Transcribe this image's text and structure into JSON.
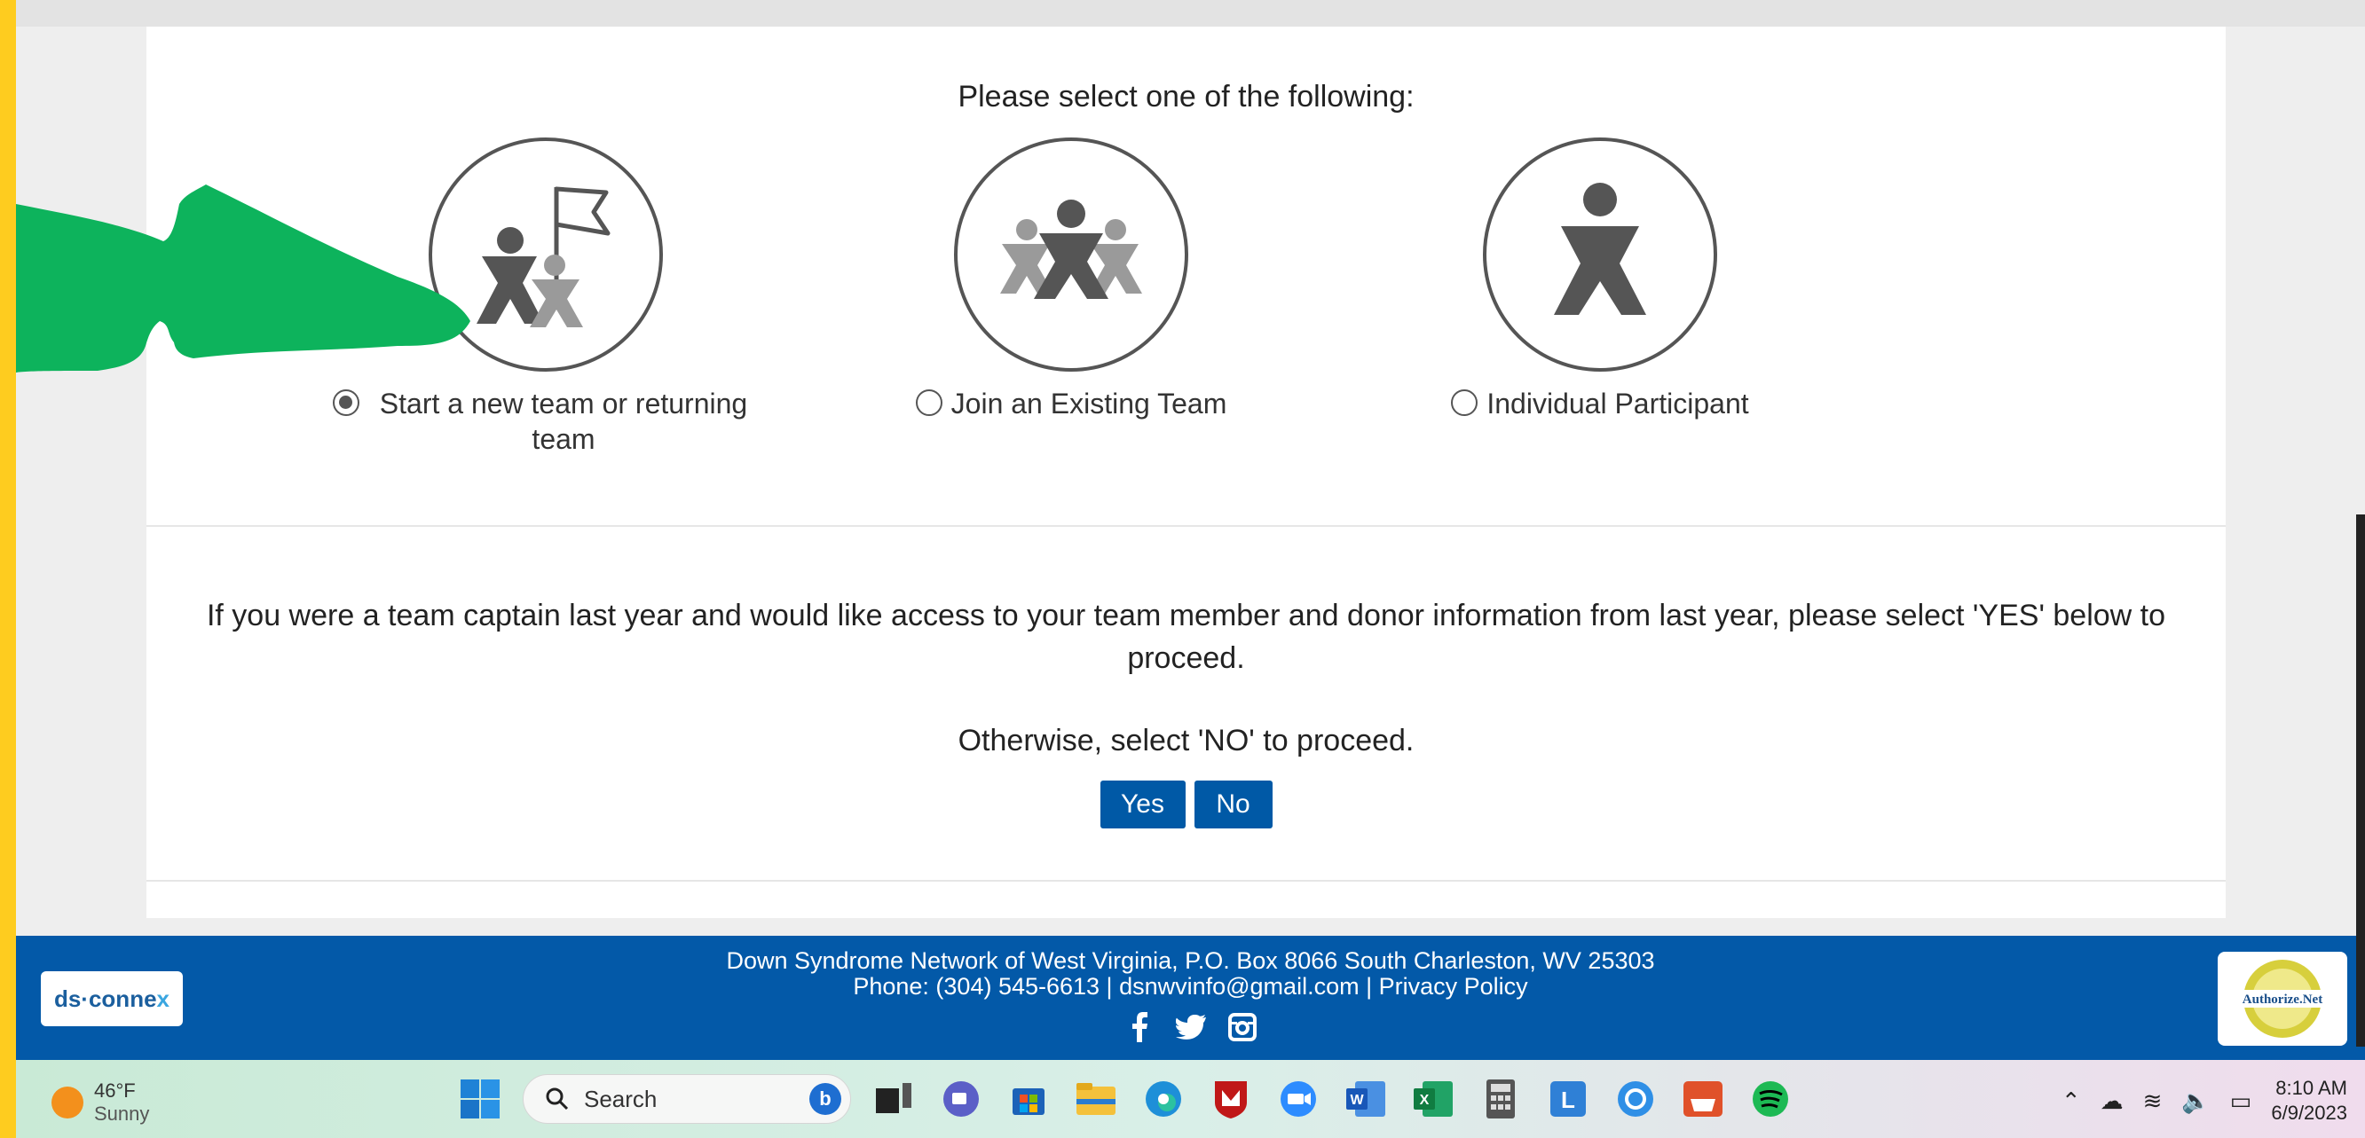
{
  "page": {
    "select_title": "Please select one of the following:",
    "options": [
      {
        "label": "Start a new team or returning team",
        "selected": true,
        "icon": "team-captain-flag-icon"
      },
      {
        "label": "Join an Existing Team",
        "selected": false,
        "icon": "team-group-icon"
      },
      {
        "label": "Individual Participant",
        "selected": false,
        "icon": "individual-person-icon"
      }
    ],
    "captain_text": "If you were a team captain last year and would like access to your team member and donor information from last year, please select 'YES' below to proceed.",
    "otherwise_text": "Otherwise, select 'NO' to proceed.",
    "yes_label": "Yes",
    "no_label": "No"
  },
  "annotation": {
    "arrow_color": "#0db35c",
    "icon": "green-arrow-icon"
  },
  "footer": {
    "line1": "Down Syndrome Network of West Virginia, P.O. Box 8066 South Charleston, WV 25303",
    "line2": "Phone: (304) 545-6613 | dsnwvinfo@gmail.com | Privacy Policy",
    "logo_text_a": "ds·conne",
    "logo_text_b": "x",
    "badge_text": "Authorize.Net",
    "social_icons": [
      "facebook-icon",
      "twitter-icon",
      "instagram-icon"
    ]
  },
  "taskbar": {
    "temperature": "46°F",
    "condition": "Sunny",
    "search_label": "Search",
    "time": "8:10 AM",
    "date": "6/9/2023"
  },
  "colors": {
    "brand_blue": "#0359a8",
    "button_blue": "#0059a6",
    "border_yellow": "#fecc1f"
  }
}
